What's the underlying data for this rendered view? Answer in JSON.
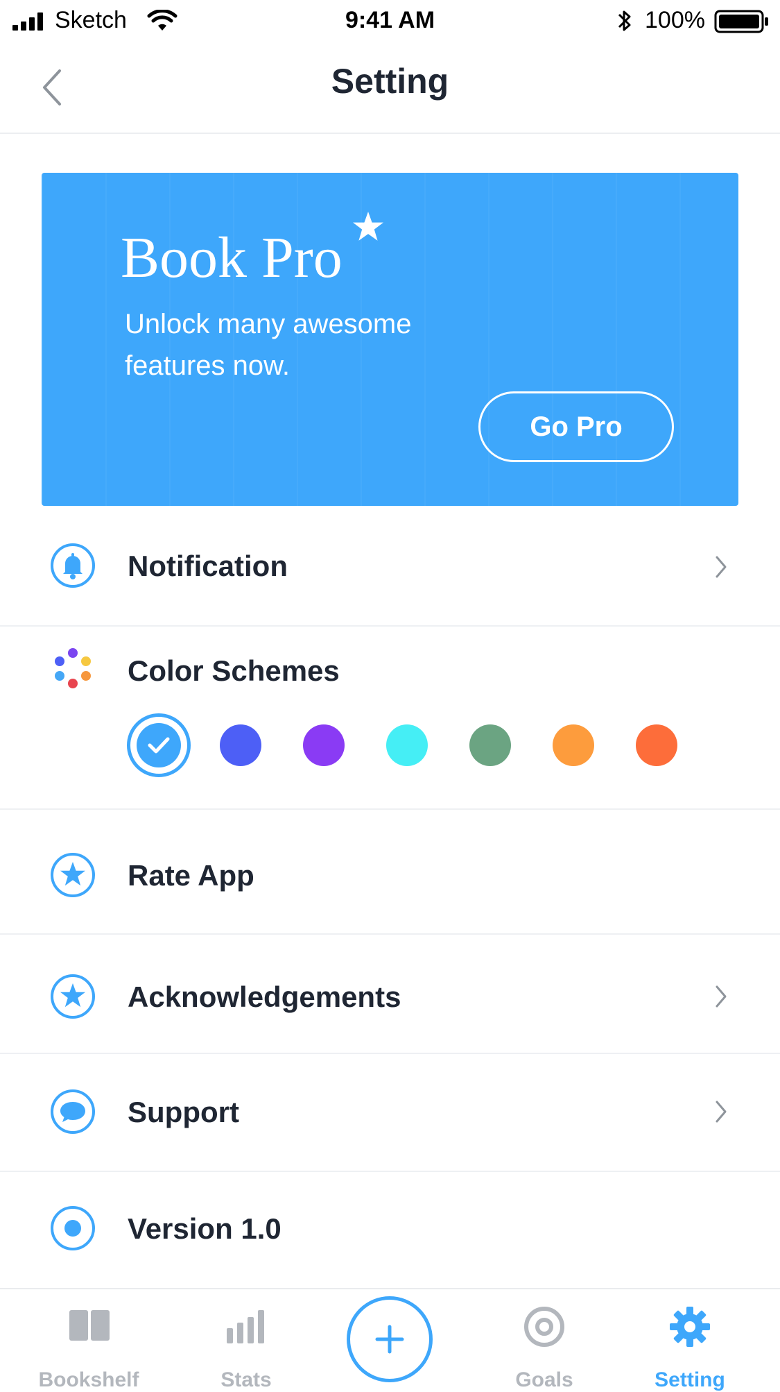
{
  "status_bar": {
    "carrier": "Sketch",
    "time": "9:41 AM",
    "battery": "100%"
  },
  "nav": {
    "title": "Setting"
  },
  "pro_card": {
    "title": "Book Pro",
    "subtitle": "Unlock many awesome features now.",
    "button": "Go Pro",
    "background": "#3ea7fb"
  },
  "settings": {
    "notification": "Notification",
    "color_schemes": "Color Schemes",
    "rate_app": "Rate App",
    "acknowledgements": "Acknowledgements",
    "support": "Support",
    "version": "Version 1.0"
  },
  "color_schemes": {
    "selected": "#3ea7fb",
    "options": [
      "#3ea7fb",
      "#4d5ff6",
      "#8a3bf4",
      "#45eef5",
      "#6ba482",
      "#fd9c3d",
      "#fd6d3a"
    ]
  },
  "tab_bar": {
    "bookshelf": "Bookshelf",
    "stats": "Stats",
    "goals": "Goals",
    "setting": "Setting",
    "active": "Setting"
  },
  "icons": {
    "back": "chevron-left-icon",
    "notification": "bell-icon",
    "color_schemes": "palette-dots-icon",
    "rate_app": "star-circle-icon",
    "acknowledgements": "star-circle-icon",
    "support": "chat-bubble-icon",
    "version": "radio-dot-icon",
    "add": "plus-icon"
  },
  "accent_color": "#3ea7fb"
}
